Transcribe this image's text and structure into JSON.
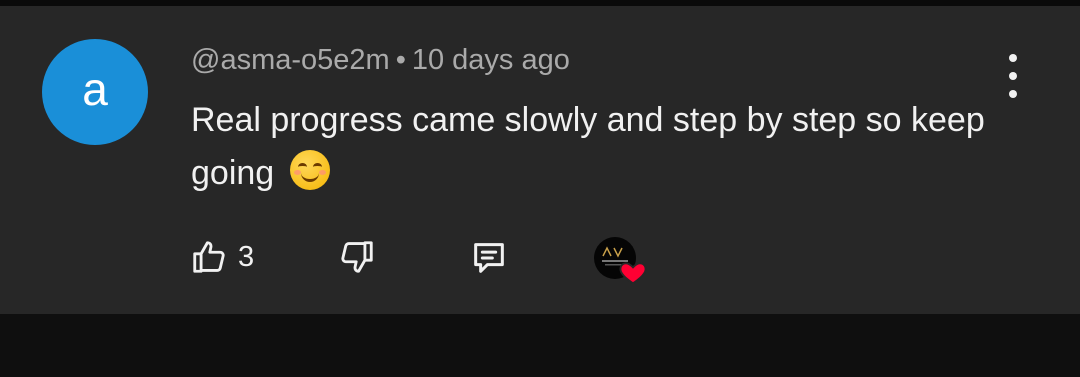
{
  "comment": {
    "avatar_letter": "a",
    "avatar_color": "#1a8fd8",
    "author": "@asma-o5e2m",
    "separator": "•",
    "time": "10 days ago",
    "text": "Real progress came slowly and step by step so keep going",
    "emoji": "smiling-face-with-smiling-eyes"
  },
  "actions": {
    "like_icon": "thumbs-up-icon",
    "like_count": "3",
    "dislike_icon": "thumbs-down-icon",
    "reply_icon": "comment-reply-icon",
    "creator_heart_icon": "heart-icon",
    "heart_color": "#ff0033"
  },
  "menu": {
    "icon": "more-vertical-icon"
  },
  "theme": {
    "card_bg": "#272727",
    "page_bg": "#0f0f0f",
    "text": "#f1f1f1",
    "muted": "#aaaaaa"
  }
}
